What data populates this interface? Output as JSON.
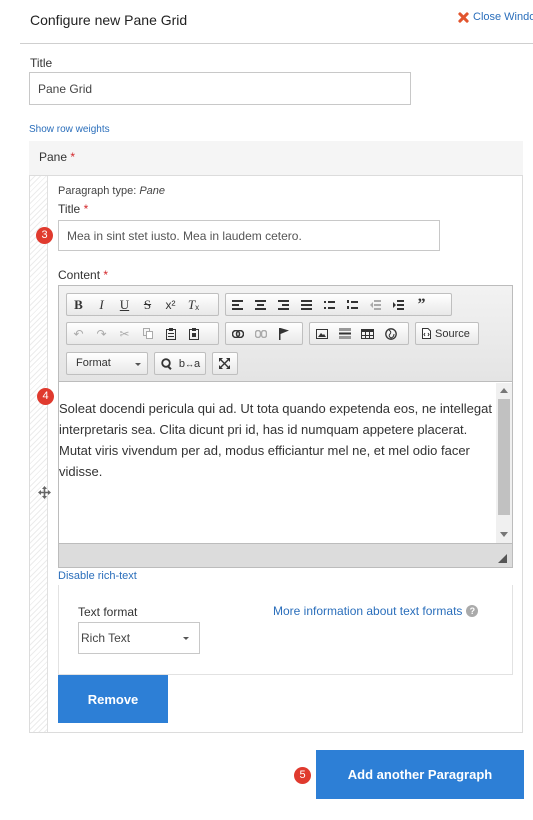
{
  "dialog": {
    "title": "Configure new Pane Grid",
    "close_label": "Close Windo"
  },
  "title_field": {
    "label": "Title",
    "value": "Pane Grid"
  },
  "show_row_weights": "Show row weights",
  "pane": {
    "header_label": "Pane",
    "required_mark": "*",
    "paragraph_type_prefix": "Paragraph type:",
    "paragraph_type_value": "Pane",
    "title_label": "Title",
    "title_value": "Mea in sint stet iusto. Mea in laudem cetero.",
    "content_label": "Content",
    "editor": {
      "format_label": "Format",
      "source_label": "Source",
      "body_text": "Soleat docendi pericula qui ad. Ut tota quando expetenda eos, ne intellegat interpretaris sea. Clita dicunt pri id, has id numquam appetere placerat. Mutat viris vivendum per ad, modus efficiantur mel ne, et mel odio facer vidisse."
    },
    "disable_rich_text": "Disable rich-text",
    "text_format": {
      "label": "Text format",
      "more_info": "More information about text formats",
      "selected": "Rich Text"
    },
    "remove_label": "Remove"
  },
  "add_paragraph_label": "Add another Paragraph",
  "badges": {
    "b3": "3",
    "b4": "4",
    "b5": "5"
  },
  "colors": {
    "primary": "#2d7fd6",
    "link": "#2a6ebb",
    "badge": "#e03a2e",
    "required": "#d3272b"
  }
}
